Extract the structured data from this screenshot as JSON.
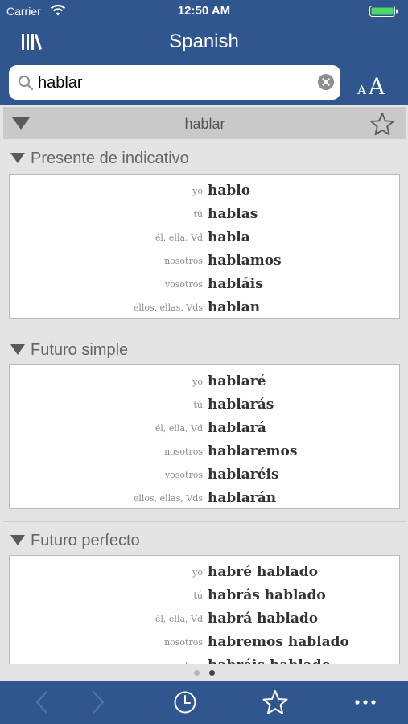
{
  "status_bar": {
    "carrier": "Carrier",
    "time": "12:50 AM"
  },
  "header": {
    "title": "Spanish"
  },
  "search": {
    "value": "hablar",
    "placeholder": ""
  },
  "verb": {
    "title": "hablar"
  },
  "sections": [
    {
      "title": "Presente de indicativo",
      "rows": [
        {
          "pronoun": "yo",
          "form": "hablo"
        },
        {
          "pronoun": "tú",
          "form": "hablas"
        },
        {
          "pronoun": "él, ella, Vd",
          "form": "habla"
        },
        {
          "pronoun": "nosotros",
          "form": "hablamos"
        },
        {
          "pronoun": "vosotros",
          "form": "habláis"
        },
        {
          "pronoun": "ellos, ellas, Vds",
          "form": "hablan"
        }
      ]
    },
    {
      "title": "Futuro simple",
      "rows": [
        {
          "pronoun": "yo",
          "form": "hablaré"
        },
        {
          "pronoun": "tú",
          "form": "hablarás"
        },
        {
          "pronoun": "él, ella, Vd",
          "form": "hablará"
        },
        {
          "pronoun": "nosotros",
          "form": "hablaremos"
        },
        {
          "pronoun": "vosotros",
          "form": "hablaréis"
        },
        {
          "pronoun": "ellos, ellas, Vds",
          "form": "hablarán"
        }
      ]
    },
    {
      "title": "Futuro perfecto",
      "rows": [
        {
          "pronoun": "yo",
          "form": "habré hablado"
        },
        {
          "pronoun": "tú",
          "form": "habrás hablado"
        },
        {
          "pronoun": "él, ella, Vd",
          "form": "habrá hablado"
        },
        {
          "pronoun": "nosotros",
          "form": "habremos hablado"
        },
        {
          "pronoun": "vosotros",
          "form": "habréis hablado"
        }
      ]
    }
  ],
  "pager": {
    "pages": 2,
    "current": 2
  },
  "font_size_icon": {
    "small": "A",
    "large": "A"
  },
  "icons": [
    "wifi-icon",
    "battery-icon",
    "library-icon",
    "search-icon",
    "clear-icon",
    "font-size-icon",
    "star-icon",
    "back-arrow-icon",
    "forward-arrow-icon",
    "history-icon",
    "favorites-icon",
    "more-icon"
  ],
  "colors": {
    "bar": "#2f568f",
    "content_bg": "#e4e4e4",
    "battery": "#4cd964"
  }
}
